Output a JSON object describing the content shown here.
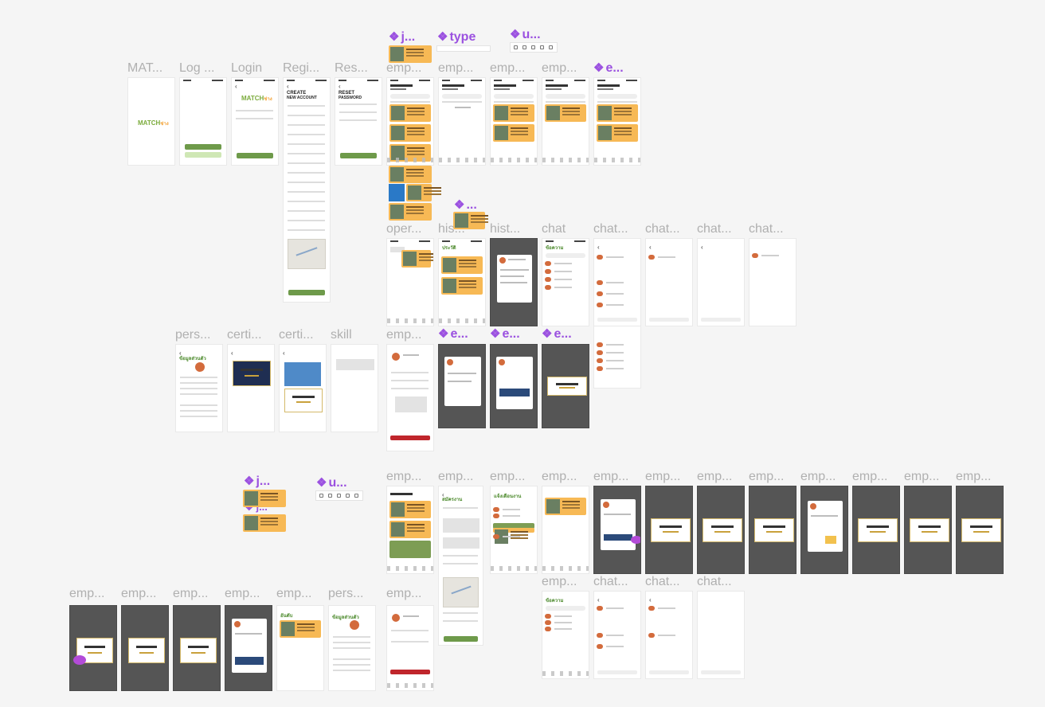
{
  "canvas": {
    "background": "#f5f5f5",
    "frames": [
      {
        "title": "MAT..."
      },
      {
        "title": "Log ..."
      },
      {
        "title": "Login"
      },
      {
        "title": "Regi..."
      },
      {
        "title": "Res..."
      },
      {
        "title": "emp..."
      },
      {
        "title": "emp..."
      },
      {
        "title": "emp..."
      },
      {
        "title": "emp..."
      },
      {
        "title": "oper..."
      },
      {
        "title": "his..."
      },
      {
        "title": "hist..."
      },
      {
        "title": "chat"
      },
      {
        "title": "chat..."
      },
      {
        "title": "chat..."
      },
      {
        "title": "chat..."
      },
      {
        "title": "chat..."
      },
      {
        "title": "pers..."
      },
      {
        "title": "certi..."
      },
      {
        "title": "certi..."
      },
      {
        "title": "skill"
      },
      {
        "title": "emp..."
      },
      {
        "title": "emp..."
      },
      {
        "title": "emp..."
      },
      {
        "title": "emp..."
      },
      {
        "title": "emp..."
      },
      {
        "title": "emp..."
      },
      {
        "title": "emp..."
      },
      {
        "title": "emp..."
      },
      {
        "title": "emp..."
      },
      {
        "title": "emp..."
      },
      {
        "title": "emp..."
      },
      {
        "title": "emp..."
      },
      {
        "title": "emp..."
      },
      {
        "title": "emp..."
      },
      {
        "title": "emp..."
      },
      {
        "title": "emp..."
      },
      {
        "title": "emp..."
      },
      {
        "title": "pers..."
      },
      {
        "title": "emp..."
      },
      {
        "title": "emp..."
      },
      {
        "title": "chat..."
      },
      {
        "title": "chat..."
      },
      {
        "title": "chat..."
      }
    ],
    "components": [
      {
        "title": "j..."
      },
      {
        "title": "type"
      },
      {
        "title": "u..."
      },
      {
        "title": "e..."
      },
      {
        "title": "..."
      },
      {
        "title": "e..."
      },
      {
        "title": "e..."
      },
      {
        "title": "e..."
      },
      {
        "title": "j..."
      },
      {
        "title": "u..."
      },
      {
        "title": "j..."
      }
    ],
    "screen_text": {
      "brand": "MATCH",
      "brand_suffix": "ช่าง",
      "create_account": "CREATE",
      "new_account": "NEW ACCOUNT",
      "reset": "RESET",
      "password": "PASSWORD",
      "history": "ประวัติ",
      "chat_title": "ข้อความ",
      "notify_title": "แจ้งเตือนงาน",
      "profile_title": "ข้อมูลส่วนตัว",
      "apply_title": "สมัครงาน",
      "rank_title": "อันดับ"
    },
    "colors": {
      "card": "#f7b955",
      "primary_green": "#6e9a4a",
      "accent_purple": "#9b51e0",
      "danger_red": "#c0262c",
      "dark_overlay": "#555555"
    }
  }
}
